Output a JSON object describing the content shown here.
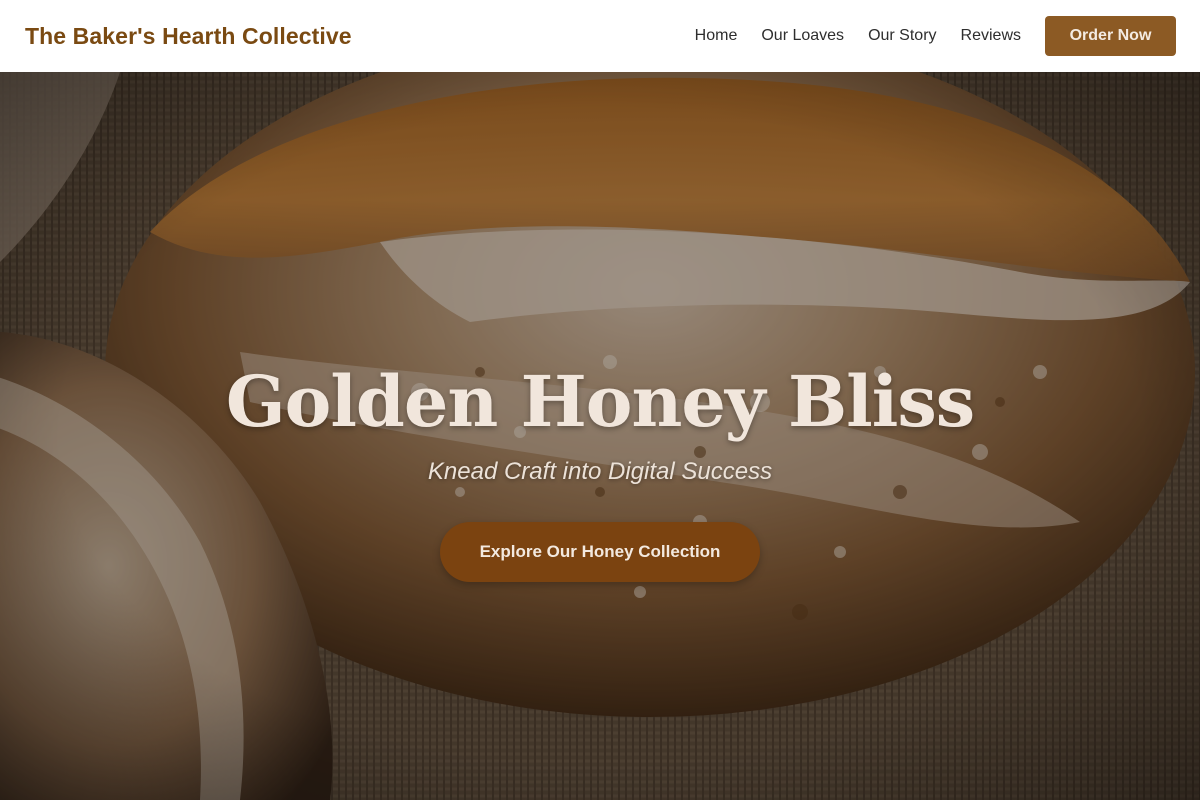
{
  "header": {
    "brand": "The Baker's Hearth Collective",
    "nav": [
      {
        "label": "Home"
      },
      {
        "label": "Our Loaves"
      },
      {
        "label": "Our Story"
      },
      {
        "label": "Reviews"
      }
    ],
    "order_label": "Order Now"
  },
  "hero": {
    "title": "Golden Honey Bliss",
    "subtitle": "Knead Craft into Digital Success",
    "cta_label": "Explore Our Honey Collection"
  },
  "colors": {
    "brand": "#7a4a12",
    "order_button": "#8c5a24",
    "cta_button": "#7b4310",
    "hero_text": "#f1e6dc"
  }
}
